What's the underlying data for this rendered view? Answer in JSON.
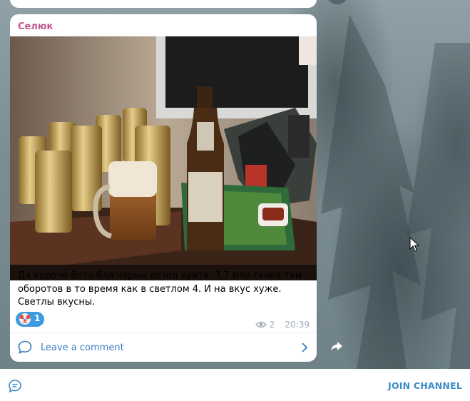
{
  "post": {
    "author": "Селюк",
    "text": "Да короче ёпта бля чорны козел хуита, 3,7 или скока там оборотов в то время  как в светлом 4. И на вкус хуже. Светлы вкусны.",
    "reaction": {
      "emoji_icon": "clown-face-icon",
      "count": "1"
    },
    "views": "2",
    "time": "20:39",
    "photo_description_icon": "photo-beer-cans-bottle-glass"
  },
  "comments": {
    "label": "Leave a comment"
  },
  "bottom_bar": {
    "join_label": "JOIN CHANNEL"
  },
  "colors": {
    "author": "#c0568e",
    "link": "#3a7bc4",
    "reaction_bg": "#3c9ae0",
    "meta": "#a0abb3",
    "join": "#3a8cc7"
  }
}
